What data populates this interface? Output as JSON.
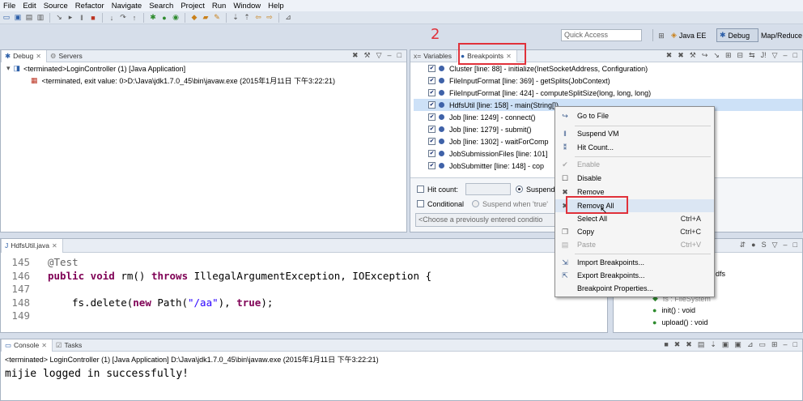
{
  "menu": [
    "File",
    "Edit",
    "Source",
    "Refactor",
    "Navigate",
    "Search",
    "Project",
    "Run",
    "Window",
    "Help"
  ],
  "quick_access_placeholder": "Quick Access",
  "perspectives": {
    "java_ee": "Java EE",
    "debug": "Debug",
    "mapreduce": "Map/Reduce"
  },
  "annotation_number": "2",
  "debug_view": {
    "tab": "Debug",
    "tab2": "Servers",
    "launch": "<terminated>LoginController (1) [Java Application]",
    "process": "<terminated, exit value: 0>D:\\Java\\jdk1.7.0_45\\bin\\javaw.exe (2015年1月11日 下午3:22:21)"
  },
  "breakpoints_view": {
    "tab_variables": "Variables",
    "tab_breakpoints": "Breakpoints",
    "items": [
      "Cluster [line: 88] - initialize(InetSocketAddress, Configuration)",
      "FileInputFormat [line: 369] - getSplits(JobContext)",
      "FileInputFormat [line: 424] - computeSplitSize(long, long, long)",
      "HdfsUtil [line: 158] - main(String[])",
      "Job [line: 1249] - connect()",
      "Job [line: 1279] - submit()",
      "Job [line: 1302] - waitForComp",
      "JobSubmissionFiles [line: 101]",
      "JobSubmitter [line: 148] - cop"
    ],
    "hit_count_label": "Hit count:",
    "suspend_label": "Suspend",
    "conditional_label": "Conditional",
    "suspend_when_label": "Suspend when 'true'",
    "choose_placeholder": "<Choose a previously entered conditio"
  },
  "context_menu": {
    "items": [
      {
        "label": "Go to File",
        "accel": "",
        "disabled": false,
        "icon": "goto-file-icon"
      },
      {
        "label": "Suspend VM",
        "accel": "",
        "disabled": false,
        "icon": "suspend-vm-icon"
      },
      {
        "label": "Hit Count...",
        "accel": "",
        "disabled": false,
        "icon": "hit-count-icon"
      },
      {
        "label": "Enable",
        "accel": "",
        "disabled": true,
        "icon": "enable-icon"
      },
      {
        "label": "Disable",
        "accel": "",
        "disabled": false,
        "icon": "disable-icon"
      },
      {
        "label": "Remove",
        "accel": "",
        "disabled": false,
        "icon": "remove-icon"
      },
      {
        "label": "Remove All",
        "accel": "",
        "disabled": false,
        "icon": "remove-all-icon"
      },
      {
        "label": "Select All",
        "accel": "Ctrl+A",
        "disabled": false,
        "icon": ""
      },
      {
        "label": "Copy",
        "accel": "Ctrl+C",
        "disabled": false,
        "icon": "copy-icon"
      },
      {
        "label": "Paste",
        "accel": "Ctrl+V",
        "disabled": true,
        "icon": "paste-icon"
      },
      {
        "label": "Import Breakpoints...",
        "accel": "",
        "disabled": false,
        "icon": "import-icon"
      },
      {
        "label": "Export Breakpoints...",
        "accel": "",
        "disabled": false,
        "icon": "export-icon"
      },
      {
        "label": "Breakpoint Properties...",
        "accel": "",
        "disabled": false,
        "icon": ""
      }
    ]
  },
  "editor": {
    "tab": "HdfsUtil.java",
    "lines": [
      {
        "num": "145",
        "text": "@Test"
      },
      {
        "num": "146",
        "text": "public void rm() throws IllegalArgumentException, IOException {"
      },
      {
        "num": "147",
        "text": ""
      },
      {
        "num": "148",
        "text": "fs.delete(new Path(\"/aa\"), true);"
      },
      {
        "num": "149",
        "text": ""
      }
    ]
  },
  "outline": {
    "items": [
      "dfs",
      "fs : FileSystem",
      "init() : void",
      "upload() : void"
    ]
  },
  "console": {
    "tab": "Console",
    "tab2": "Tasks",
    "header": "<terminated> LoginController (1) [Java Application] D:\\Java\\jdk1.7.0_45\\bin\\javaw.exe (2015年1月11日 下午3:22:21)",
    "output": "mijie logged in successfully!"
  },
  "colors": {
    "highlight": "#e0313a",
    "keyword": "#7f0055",
    "string": "#2a00ff"
  }
}
